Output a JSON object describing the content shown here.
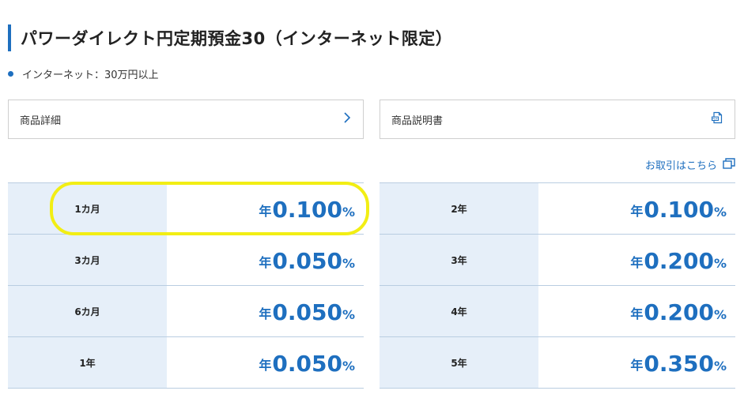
{
  "page": {
    "title": "パワーダイレクト円定期預金30（インターネット限定）",
    "note": "インターネット：30万円以上"
  },
  "links": {
    "product_detail": "商品詳細",
    "product_doc": "商品説明書",
    "transaction": "お取引はこちら"
  },
  "rates": {
    "left": [
      {
        "term": "1カ月",
        "prefix": "年",
        "value": "0.100",
        "unit": "%"
      },
      {
        "term": "3カ月",
        "prefix": "年",
        "value": "0.050",
        "unit": "%"
      },
      {
        "term": "6カ月",
        "prefix": "年",
        "value": "0.050",
        "unit": "%"
      },
      {
        "term": "1年",
        "prefix": "年",
        "value": "0.050",
        "unit": "%"
      }
    ],
    "right": [
      {
        "term": "2年",
        "prefix": "年",
        "value": "0.100",
        "unit": "%"
      },
      {
        "term": "3年",
        "prefix": "年",
        "value": "0.200",
        "unit": "%"
      },
      {
        "term": "4年",
        "prefix": "年",
        "value": "0.200",
        "unit": "%"
      },
      {
        "term": "5年",
        "prefix": "年",
        "value": "0.350",
        "unit": "%"
      }
    ]
  },
  "colors": {
    "accent": "#1e6fbf",
    "term_bg": "#e6eff9",
    "highlight": "#f2ee14"
  },
  "icons": {
    "chevron": "chevron-right-icon",
    "pdf": "pdf-icon",
    "external": "external-window-icon"
  }
}
